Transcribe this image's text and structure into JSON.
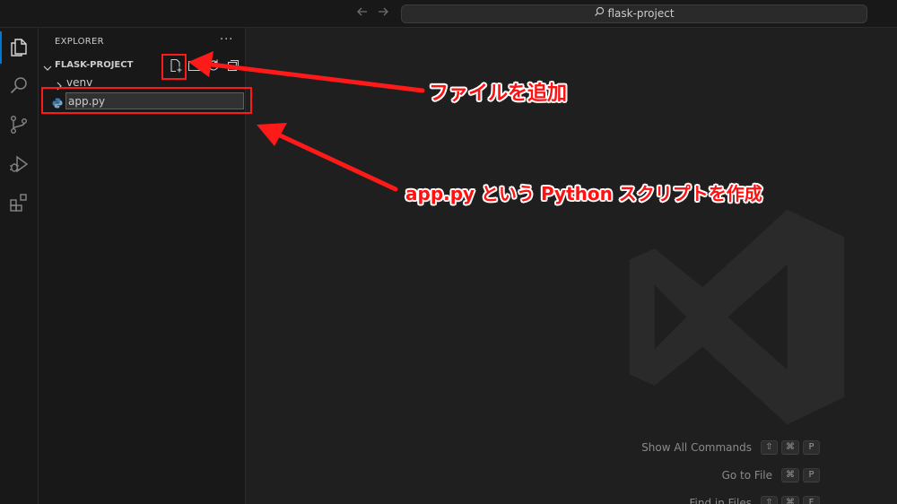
{
  "titlebar": {
    "back_icon": "arrow-left-icon",
    "forward_icon": "arrow-right-icon",
    "search_text": "flask-project"
  },
  "activity_bar": {
    "items": [
      "explorer-icon",
      "search-icon",
      "source-control-icon",
      "run-debug-icon",
      "extensions-icon"
    ],
    "active": "explorer-icon",
    "accent_color": "#0078d4"
  },
  "sidebar": {
    "title": "EXPLORER",
    "more_label": "···",
    "project": {
      "name": "FLASK-PROJECT",
      "tools": [
        "new-file-icon",
        "new-folder-icon",
        "refresh-icon",
        "collapse-all-icon"
      ]
    },
    "tree": [
      {
        "type": "folder",
        "label": "venv"
      },
      {
        "type": "file",
        "icon": "python-icon",
        "editing_value": "app.py"
      }
    ]
  },
  "editor": {
    "watermark_icon": "vscode-logo-icon",
    "shortcuts": [
      {
        "label": "Show All Commands",
        "keys": [
          "⇧",
          "⌘",
          "P"
        ]
      },
      {
        "label": "Go to File",
        "keys": [
          "⌘",
          "P"
        ]
      },
      {
        "label": "Find in Files",
        "keys": [
          "⇧",
          "⌘",
          "F"
        ]
      }
    ]
  },
  "annotations": {
    "color": "#ff1a1a",
    "new_file_callout": "ファイルを追加",
    "create_script_callout": "app.py という Python スクリプトを作成"
  }
}
